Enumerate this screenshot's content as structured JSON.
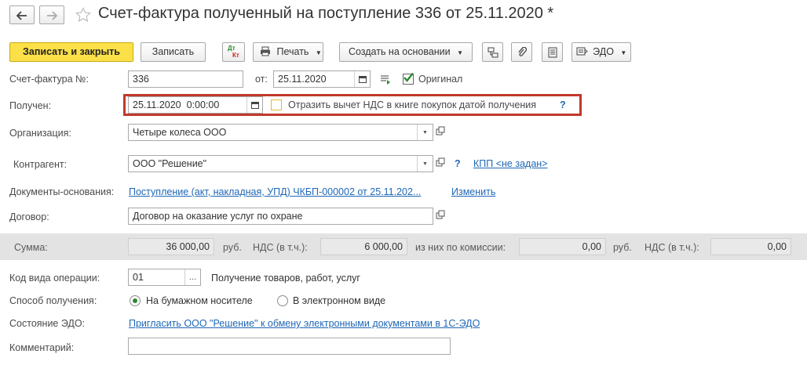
{
  "header": {
    "title": "Счет-фактура полученный на поступление 336 от 25.11.2020 *"
  },
  "toolbar": {
    "save_close": "Записать и закрыть",
    "save": "Записать",
    "dtkt_dt": "Дт",
    "dtkt_kt": "Кт",
    "print": "Печать",
    "create_based": "Создать на основании",
    "edo": "ЭДО"
  },
  "form": {
    "invoice_label": "Счет-фактура №:",
    "invoice_number": "336",
    "from_label": "от:",
    "invoice_date": "25.11.2020",
    "original_label": "Оригинал",
    "received_label": "Получен:",
    "received_datetime": "25.11.2020  0:00:00",
    "vat_deduction_label": "Отразить вычет НДС в книге покупок датой получения",
    "help_mark": "?",
    "org_label": "Организация:",
    "org_value": "Четыре колеса ООО",
    "counterparty_label": "Контрагент:",
    "counterparty_value": "ООО \"Решение\"",
    "kpp_link": "КПП <не задан>",
    "docs_label": "Документы-основания:",
    "docs_link": "Поступление (акт, накладная, УПД) ЧКБП-000002 от 25.11.202...",
    "change_link": "Изменить",
    "contract_label": "Договор:",
    "contract_value": "Договор на оказание услуг по охране",
    "op_code_label": "Код вида операции:",
    "op_code_value": "01",
    "op_code_desc": "Получение товаров, работ, услуг",
    "method_label": "Способ получения:",
    "method_paper": "На бумажном носителе",
    "method_electronic": "В электронном виде",
    "edo_state_label": "Состояние ЭДО:",
    "edo_invite_link": "Пригласить ООО \"Решение\" к обмену электронными документами в 1С-ЭДО",
    "comment_label": "Комментарий:",
    "comment_value": "",
    "ellipsis": "..."
  },
  "sum_bar": {
    "sum_label": "Сумма:",
    "sum_value": "36 000,00",
    "currency": "руб.",
    "vat_label": "НДС (в т.ч.):",
    "vat_value": "6 000,00",
    "commission_label": "из них по комиссии:",
    "commission_value": "0,00",
    "currency2": "руб.",
    "vat2_label": "НДС (в т.ч.):",
    "vat2_value": "0,00"
  },
  "colors": {
    "accent_yellow": "#fbe047",
    "link_blue": "#1f67b6",
    "highlight_red": "#c0392b",
    "check_green": "#2e8b2e"
  }
}
